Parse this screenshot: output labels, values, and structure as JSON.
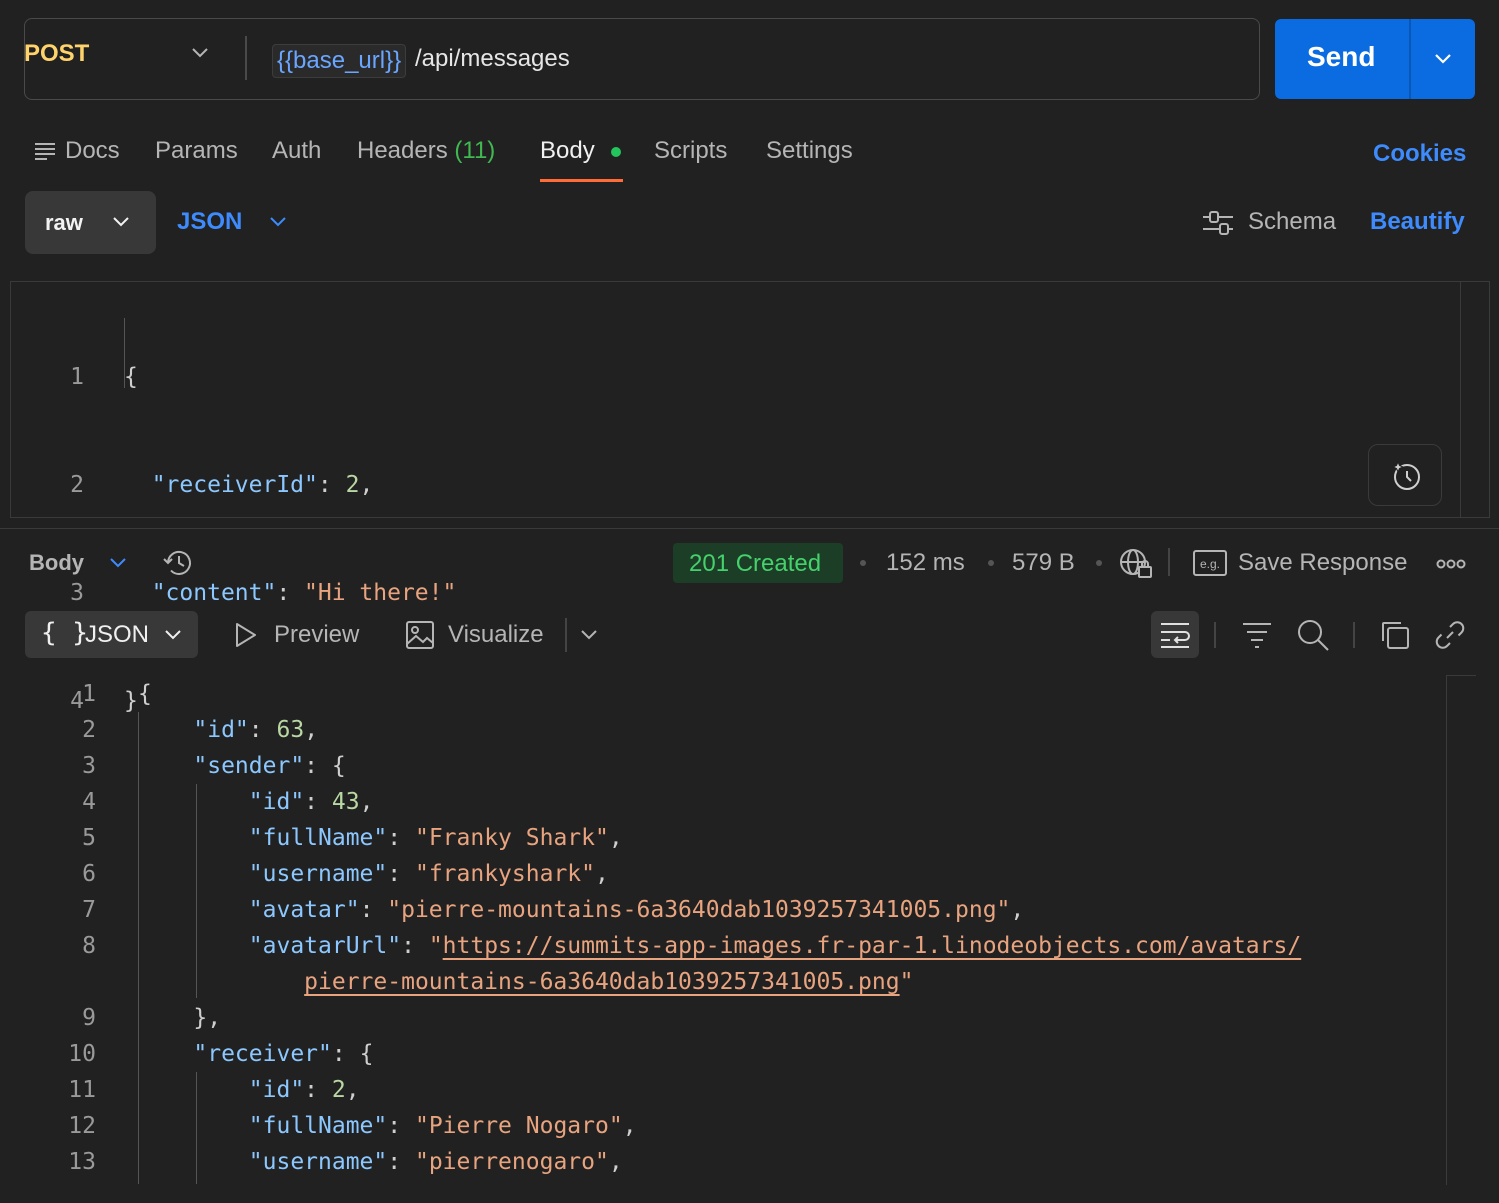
{
  "request": {
    "method": "POST",
    "url_variable": "{{base_url}}",
    "url_path": "/api/messages",
    "send_label": "Send"
  },
  "tabs": {
    "docs": "Docs",
    "params": "Params",
    "auth": "Auth",
    "headers": "Headers",
    "headers_count": "(11)",
    "body": "Body",
    "scripts": "Scripts",
    "settings": "Settings",
    "cookies": "Cookies"
  },
  "body_toolbar": {
    "mode": "raw",
    "language": "JSON",
    "schema": "Schema",
    "beautify": "Beautify"
  },
  "request_body": {
    "line_numbers": [
      "1",
      "2",
      "3",
      "4"
    ],
    "open_brace": "{",
    "close_brace": "}",
    "receiverId_key": "\"receiverId\"",
    "receiverId_value": "2",
    "content_key": "\"content\"",
    "content_value": "\"Hi there!\""
  },
  "response_toolbar": {
    "body_label": "Body",
    "status": "201 Created",
    "time": "152 ms",
    "size": "579 B",
    "save_response": "Save Response",
    "more": "ooo"
  },
  "response_view": {
    "format": "JSON",
    "format_braces": "{ }",
    "preview": "Preview",
    "visualize": "Visualize"
  },
  "response_body": {
    "line_numbers": [
      "1",
      "2",
      "3",
      "4",
      "5",
      "6",
      "7",
      "8",
      "",
      "9",
      "10",
      "11",
      "12",
      "13"
    ],
    "lines": [
      {
        "indent": 0,
        "key": "",
        "value": "",
        "punct": "{"
      },
      {
        "indent": 1,
        "key": "\"id\"",
        "value": "63",
        "type": "n",
        "punct": ","
      },
      {
        "indent": 1,
        "key": "\"sender\"",
        "value": "",
        "punct": "{"
      },
      {
        "indent": 2,
        "key": "\"id\"",
        "value": "43",
        "type": "n",
        "punct": ","
      },
      {
        "indent": 2,
        "key": "\"fullName\"",
        "value": "\"Franky Shark\"",
        "type": "s",
        "punct": ","
      },
      {
        "indent": 2,
        "key": "\"username\"",
        "value": "\"frankyshark\"",
        "type": "s",
        "punct": ","
      },
      {
        "indent": 2,
        "key": "\"avatar\"",
        "value": "\"pierre-mountains-6a3640dab1039257341005.png\"",
        "type": "s",
        "punct": ","
      },
      {
        "indent": 2,
        "key": "\"avatarUrl\"",
        "value": "https://summits-app-images.fr-par-1.linodeobjects.com/avatars/",
        "type": "u",
        "punct": ""
      },
      {
        "indent": 3,
        "key": "",
        "value": "pierre-mountains-6a3640dab1039257341005.png",
        "type": "u2",
        "punct": ""
      },
      {
        "indent": 1,
        "key": "",
        "value": "",
        "punct": "},"
      },
      {
        "indent": 1,
        "key": "\"receiver\"",
        "value": "",
        "punct": "{"
      },
      {
        "indent": 2,
        "key": "\"id\"",
        "value": "2",
        "type": "n",
        "punct": ","
      },
      {
        "indent": 2,
        "key": "\"fullName\"",
        "value": "\"Pierre Nogaro\"",
        "type": "s",
        "punct": ","
      },
      {
        "indent": 2,
        "key": "\"username\"",
        "value": "\"pierrenogaro\"",
        "type": "s",
        "punct": ","
      }
    ]
  },
  "colors": {
    "background": "#212121",
    "send_button": "#0a6ce0",
    "method": "#ffd36b",
    "accent_link": "#3d8bfd",
    "status_green": "#45d16b",
    "tab_underline": "#ff6c37",
    "json_key": "#8cc8ff",
    "json_string": "#e8a37f",
    "json_number": "#b8d7a3"
  },
  "icons": {
    "method_chevron": "chevron-down-icon",
    "send_chevron": "chevron-down-icon",
    "docs": "lines-icon",
    "schema": "sliders-icon",
    "ai": "sparkle-clock-icon",
    "history": "history-icon",
    "globe": "globe-lock-icon",
    "save_response": "example-icon",
    "preview": "play-icon",
    "visualize": "image-icon",
    "wrap": "wrap-lines-icon",
    "filter": "filter-icon",
    "search": "search-icon",
    "copy": "copy-icon",
    "link": "link-icon"
  }
}
